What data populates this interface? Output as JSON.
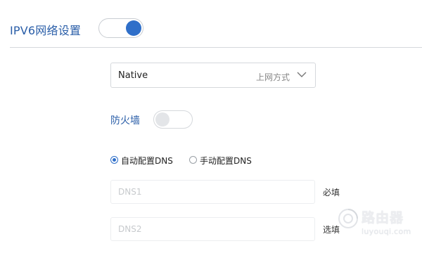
{
  "header": {
    "title": "IPV6网络设置",
    "ipv6_enabled": true
  },
  "connection": {
    "selected_value": "Native",
    "hint": "上网方式",
    "icon": "chevron-down-icon"
  },
  "firewall": {
    "label": "防火墙",
    "enabled": false
  },
  "dns_mode": {
    "options": [
      {
        "label": "自动配置DNS",
        "checked": true
      },
      {
        "label": "手动配置DNS",
        "checked": false
      }
    ]
  },
  "dns_fields": [
    {
      "placeholder": "DNS1",
      "note": "必填"
    },
    {
      "placeholder": "DNS2",
      "note": "选填"
    }
  ],
  "watermark": {
    "title": "路由器",
    "url": "luyouqi.com"
  },
  "colors": {
    "accent": "#2f6fc9",
    "title": "#2a5ea8",
    "border": "#d5d8dc",
    "placeholder": "#c7cacd"
  }
}
